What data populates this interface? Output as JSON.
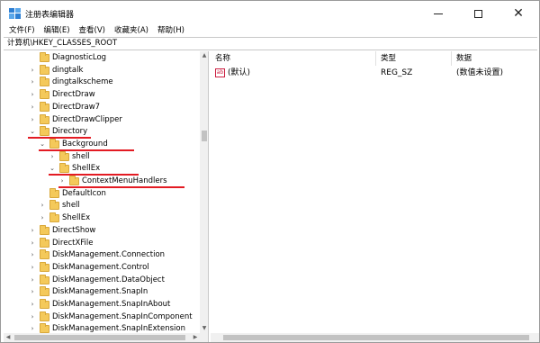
{
  "window": {
    "title": "注册表编辑器"
  },
  "menu": [
    "文件(F)",
    "编辑(E)",
    "查看(V)",
    "收藏夹(A)",
    "帮助(H)"
  ],
  "address": "计算机\\HKEY_CLASSES_ROOT",
  "tree": [
    {
      "label": "DiagnosticLog",
      "expander": ""
    },
    {
      "label": "dingtalk",
      "expander": "›"
    },
    {
      "label": "dingtalkscheme",
      "expander": "›"
    },
    {
      "label": "DirectDraw",
      "expander": "›"
    },
    {
      "label": "DirectDraw7",
      "expander": "›"
    },
    {
      "label": "DirectDrawClipper",
      "expander": "›"
    },
    {
      "label": "Directory",
      "expander": "⌄"
    },
    {
      "label": "Background",
      "expander": "⌄"
    },
    {
      "label": "shell",
      "expander": "›"
    },
    {
      "label": "ShellEx",
      "expander": "⌄"
    },
    {
      "label": "ContextMenuHandlers",
      "expander": "›"
    },
    {
      "label": "DefaultIcon",
      "expander": ""
    },
    {
      "label": "shell",
      "expander": "›"
    },
    {
      "label": "ShellEx",
      "expander": "›"
    },
    {
      "label": "DirectShow",
      "expander": "›"
    },
    {
      "label": "DirectXFile",
      "expander": "›"
    },
    {
      "label": "DiskManagement.Connection",
      "expander": "›"
    },
    {
      "label": "DiskManagement.Control",
      "expander": "›"
    },
    {
      "label": "DiskManagement.DataObject",
      "expander": "›"
    },
    {
      "label": "DiskManagement.SnapIn",
      "expander": "›"
    },
    {
      "label": "DiskManagement.SnapInAbout",
      "expander": "›"
    },
    {
      "label": "DiskManagement.SnapInComponent",
      "expander": "›"
    },
    {
      "label": "DiskManagement.SnapInExtension",
      "expander": "›"
    }
  ],
  "columns": {
    "name": "名称",
    "type": "类型",
    "data": "数据"
  },
  "values": [
    {
      "name": "(默认)",
      "type": "REG_SZ",
      "data": "(数值未设置)"
    }
  ],
  "colors": {
    "highlight_underline": "#e31b23",
    "folder": "#f4c95a"
  }
}
